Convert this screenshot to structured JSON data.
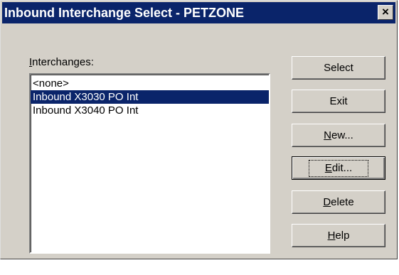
{
  "window": {
    "title": "Inbound Interchange Select - PETZONE",
    "close_glyph": "×"
  },
  "interchanges": {
    "label_mnemonic": "I",
    "label_rest": "nterchanges:",
    "items": [
      {
        "label": "<none>",
        "selected": false
      },
      {
        "label": "Inbound X3030 PO Int",
        "selected": true
      },
      {
        "label": "Inbound X3040 PO Int",
        "selected": false
      }
    ]
  },
  "buttons": {
    "select": "Select",
    "exit": "Exit",
    "new_mnemonic": "N",
    "new_rest": "ew...",
    "edit_mnemonic": "E",
    "edit_rest": "dit...",
    "delete_mnemonic": "D",
    "delete_rest": "elete",
    "help_mnemonic": "H",
    "help_rest": "elp"
  },
  "colors": {
    "title_bar": "#0a246a",
    "selection": "#0a246a",
    "face": "#d4d0c8"
  }
}
